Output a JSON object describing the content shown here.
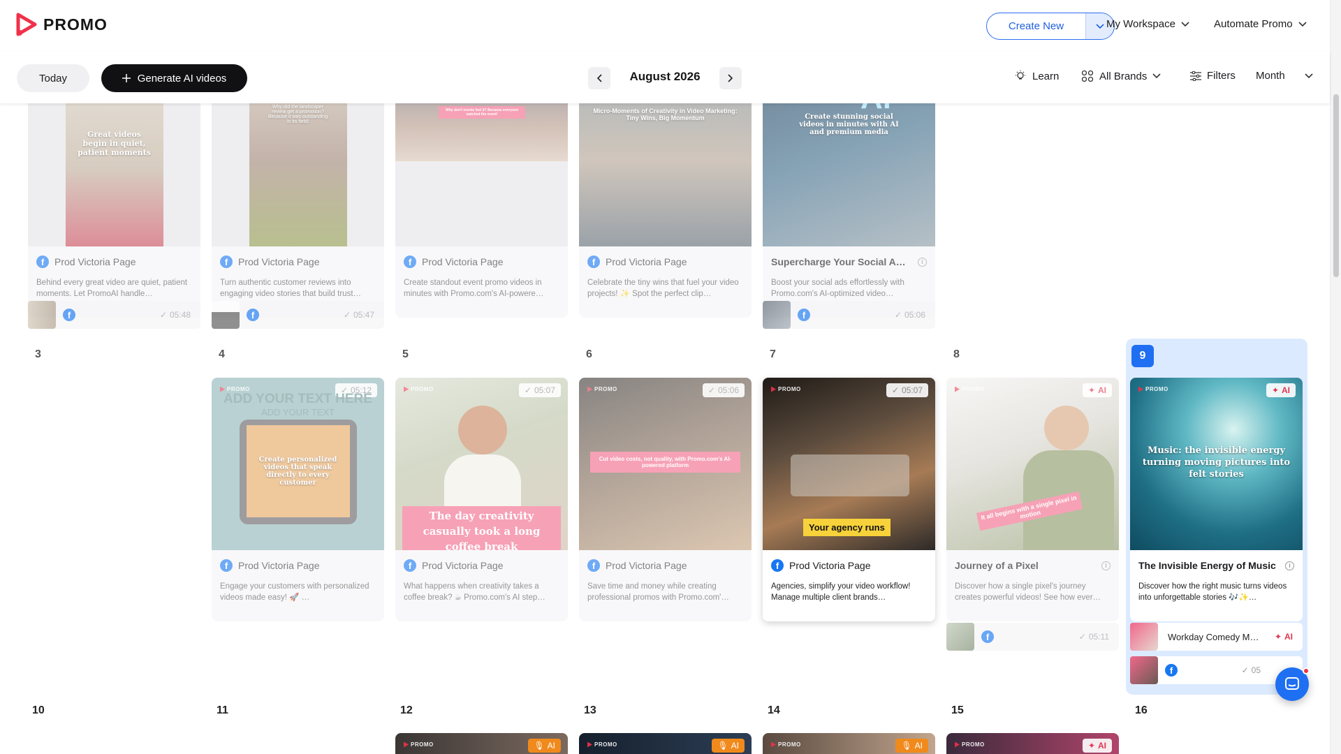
{
  "app": {
    "name": "PROMO"
  },
  "header": {
    "create_new": "Create New",
    "workspace": "My Workspace",
    "automate": "Automate Promo"
  },
  "toolbar": {
    "today": "Today",
    "generate": "Generate AI videos",
    "month_label": "August 2026",
    "learn": "Learn",
    "brands": "All Brands",
    "filters": "Filters",
    "view": "Month"
  },
  "colors": {
    "accent": "#1f6ff2",
    "brand_red": "#f0314a",
    "facebook": "#1877f2"
  },
  "week1": [
    {
      "page": "Prod Victoria Page",
      "desc": "Behind every great video are quiet, patient moments. Let PromoAI handle…",
      "thumb_text": "Great videos begin in quiet, patient moments",
      "strip_time": "05:48"
    },
    {
      "page": "Prod Victoria Page",
      "desc": "Turn authentic customer reviews into engaging video stories that build trust…",
      "thumb_text": "Why did the landscaper review get a promotion? Because it was outstanding in its field!",
      "strip_time": "05:47"
    },
    {
      "page": "Prod Victoria Page",
      "desc": "Create standout event promo videos in minutes with Promo.com's AI-powere…",
      "thumb_text": "Why don't events feel it? Because everyone watched the event!"
    },
    {
      "page": "Prod Victoria Page",
      "desc": "Celebrate the tiny wins that fuel your video projects! ✨ Spot the perfect clip…",
      "thumb_text": "Micro-Moments of Creativity in Video Marketing: Tiny Wins, Big Momentum"
    },
    {
      "page": "Supercharge Your Social A…",
      "desc": "Boost your social ads effortlessly with Promo.com's AI-optimized video…",
      "thumb_text": "Create stunning social videos in minutes with AI and premium media",
      "strip_time": "05:06"
    }
  ],
  "week2_days": [
    "3",
    "4",
    "5",
    "6",
    "7",
    "8",
    "9"
  ],
  "week2": [
    {
      "page": "Prod Victoria Page",
      "desc": "Engage your customers with personalized videos made easy! 🚀 …",
      "time": "05:12",
      "thumb_title": "ADD YOUR TEXT HERE",
      "thumb_sub": "ADD YOUR TEXT",
      "thumb_text": "Create personalized videos that speak directly to every customer"
    },
    {
      "page": "Prod Victoria Page",
      "desc": "What happens when creativity takes a coffee break? ☕ Promo.com's AI step…",
      "time": "05:07",
      "thumb_text": "The day creativity casually took a long coffee break"
    },
    {
      "page": "Prod Victoria Page",
      "desc": "Save time and money while creating professional promos with Promo.com'…",
      "time": "05:06",
      "thumb_text": "Cut video costs, not quality, with Promo.com's AI-powered platform"
    },
    {
      "page": "Prod Victoria Page",
      "desc": "Agencies, simplify your video workflow! Manage multiple client brands…",
      "time": "05:07",
      "thumb_text": "Your agency runs"
    },
    {
      "page": "Journey of a Pixel",
      "desc": "Discover how a single pixel's journey creates powerful videos! See how ever…",
      "badge": "AI",
      "thumb_text": "It all begins with a single pixel in motion",
      "strip_time": "05:11"
    },
    {
      "page": "The Invisible Energy of Music",
      "desc": "Discover how the right music turns videos into unforgettable stories 🎶✨…",
      "badge": "AI",
      "thumb_text": "Music: the invisible energy turning moving pictures into felt stories",
      "strip_title": "Workday Comedy M…",
      "strip_badge": "AI",
      "strip_time": "05"
    }
  ],
  "week3_days": [
    "10",
    "11",
    "12",
    "13",
    "14",
    "15",
    "16"
  ],
  "week3_badges": [
    "AI",
    "AI",
    "AI",
    "AI"
  ]
}
